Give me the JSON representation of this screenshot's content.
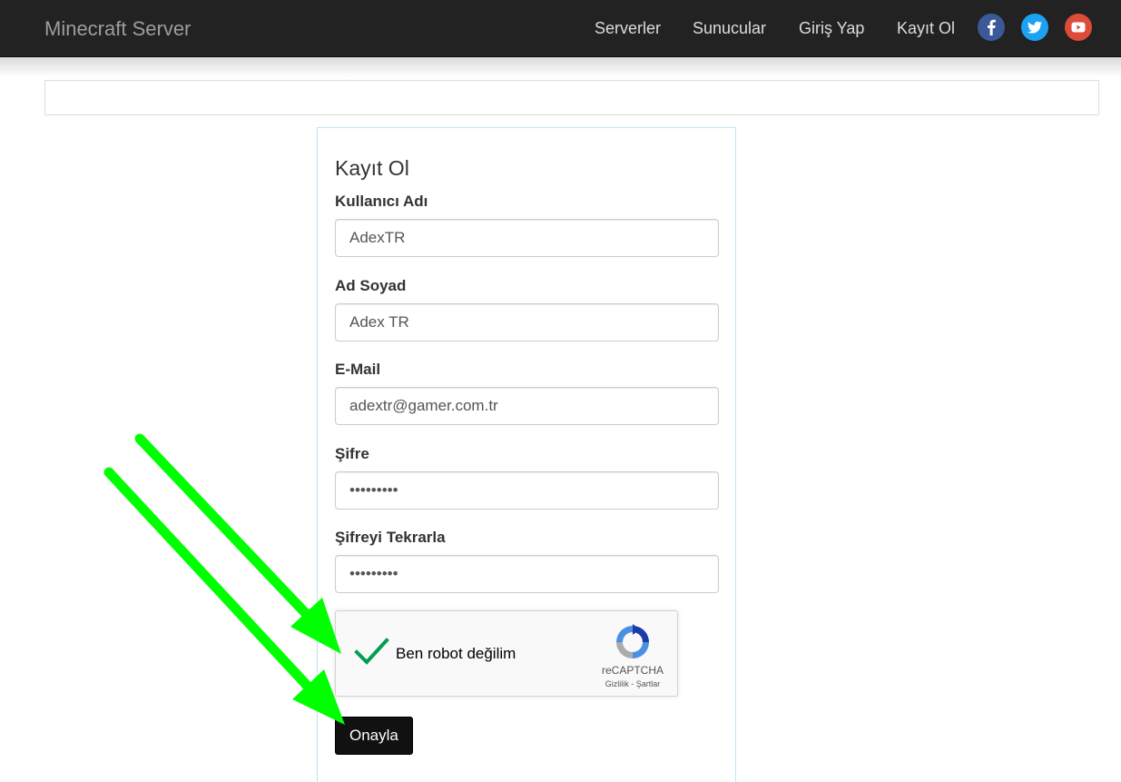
{
  "navbar": {
    "brand": "Minecraft Server",
    "links": [
      "Serverler",
      "Sunucular",
      "Giriş Yap",
      "Kayıt Ol"
    ],
    "social": [
      {
        "icon": "facebook-icon",
        "color": "#3b5998"
      },
      {
        "icon": "twitter-icon",
        "color": "#1da1f2"
      },
      {
        "icon": "youtube-icon",
        "color": "#dd4b39"
      }
    ]
  },
  "form": {
    "title": "Kayıt Ol",
    "fields": [
      {
        "label": "Kullanıcı Adı",
        "value": "AdexTR"
      },
      {
        "label": "Ad Soyad",
        "value": "Adex TR"
      },
      {
        "label": "E-Mail",
        "value": "adextr@gamer.com.tr"
      },
      {
        "label": "Şifre",
        "value": "•••••••••"
      },
      {
        "label": "Şifreyi Tekrarla",
        "value": "•••••••••"
      }
    ],
    "captcha": {
      "label": "Ben robot değilim",
      "brand": "reCAPTCHA",
      "links": "Gizlilik - Şartlar",
      "check_color": "#009e55"
    },
    "submit_label": "Onayla"
  },
  "colors": {
    "navbar_bg": "#222222",
    "panel_border": "#bce8f1",
    "arrow": "#00ff00"
  }
}
